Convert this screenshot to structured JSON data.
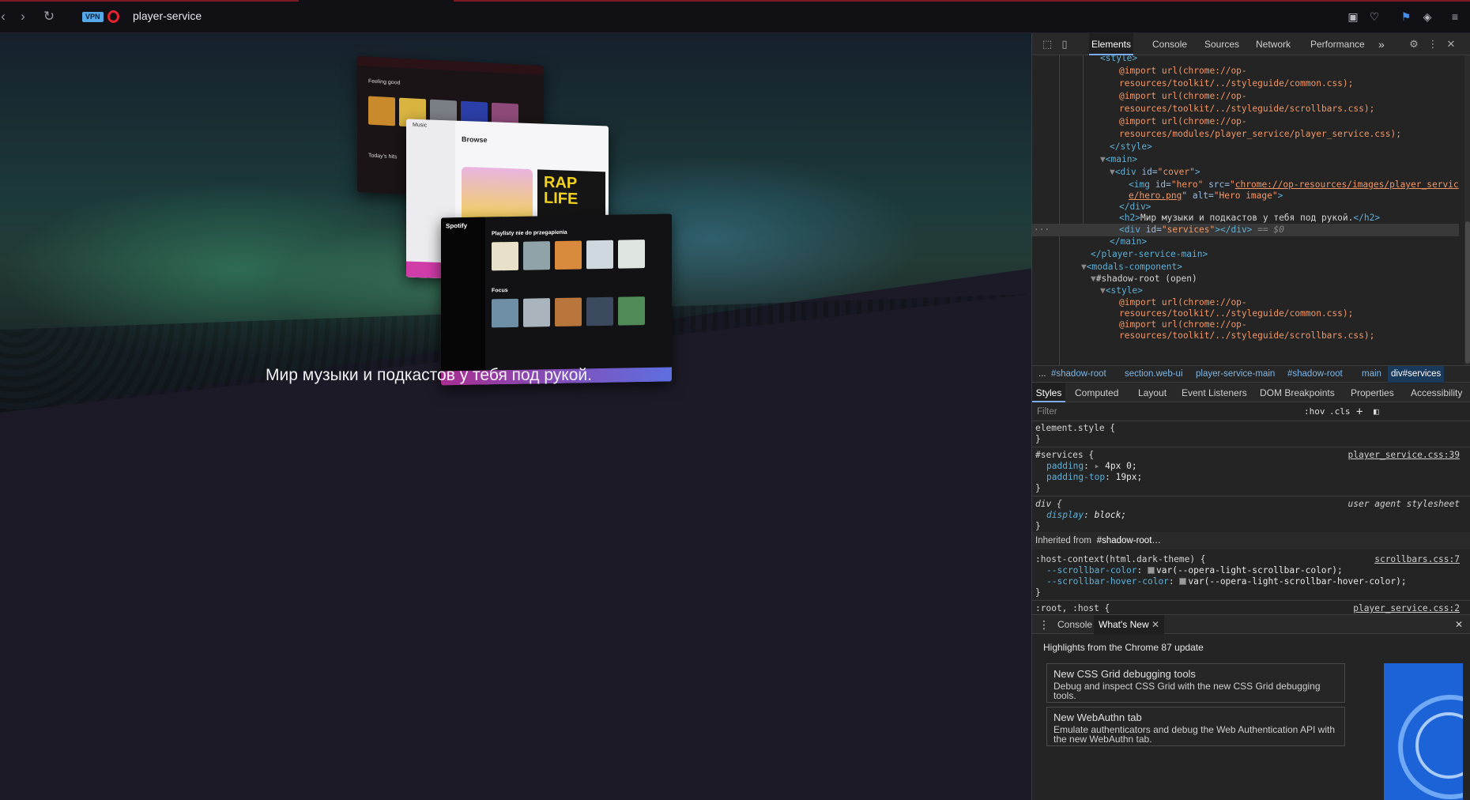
{
  "browser": {
    "vpn_label": "VPN",
    "address": "player-service",
    "back_icon": "chevron-left-icon",
    "forward_icon": "chevron-right-icon",
    "reload_icon": "reload-icon"
  },
  "page": {
    "headline": "Мир музыки и подкастов у тебя под рукой.",
    "preview": {
      "ytm_heading": "Feeling good",
      "ytm_subheading": "Today's hits",
      "apple_brand": "Music",
      "apple_title": "Browse",
      "rap_title": "RAP LIFE",
      "spotify_brand": "Spotify",
      "spotify_heading": "Playlisty nie do przegapienia",
      "spotify_subheading": "Focus"
    }
  },
  "devtools": {
    "tabs": [
      "Elements",
      "Console",
      "Sources",
      "Network",
      "Performance"
    ],
    "more_tabs": "»",
    "dom": {
      "l1": "<style>",
      "l2": "@import url(chrome://op-",
      "l3": "resources/toolkit/../styleguide/common.css);",
      "l4": "@import url(chrome://op-",
      "l5": "resources/toolkit/../styleguide/scrollbars.css);",
      "l6": "@import url(chrome://op-",
      "l7": "resources/modules/player_service/player_service.css);",
      "l8": "</style>",
      "l9": "<main>",
      "l10_tag": "<div ",
      "l10_attr": "id=",
      "l10_val": "\"cover\"",
      "l10_end": ">",
      "l11_tag": "<img ",
      "l11_attr1": "id=",
      "l11_val1": "\"hero\"",
      "l11_attr2": " src=",
      "l11_link1": "chrome://op-resources/images/player_servic",
      "l12_link2": "e/hero.png",
      "l12_attr3": "\" alt=",
      "l12_val3": "\"Hero image\"",
      "l12_end": ">",
      "l13": "</div>",
      "l14_tag": "<h2>",
      "l14_text": "Мир музыки и подкастов у тебя под рукой.",
      "l14_end": "</h2>",
      "l15_tag": "<div ",
      "l15_attr": "id=",
      "l15_val": "\"services\"",
      "l15_end": "></div>",
      "l15_ref": " == $0",
      "l16": "</main>",
      "l17": "</player-service-main>",
      "l18": "<modals-component>",
      "l19": "#shadow-root (open)",
      "l20": "<style>",
      "l21": "@import url(chrome://op-",
      "l22": "resources/toolkit/../styleguide/common.css);",
      "l23": "@import url(chrome://op-",
      "l24": "resources/toolkit/../styleguide/scrollbars.css);"
    },
    "breadcrumbs": [
      "...",
      "#shadow-root",
      "section.web-ui",
      "player-service-main",
      "#shadow-root",
      "main",
      "div#services"
    ],
    "styles_tabs": [
      "Styles",
      "Computed",
      "Layout",
      "Event Listeners",
      "DOM Breakpoints",
      "Properties",
      "Accessibility"
    ],
    "filter_placeholder": "Filter",
    "hov": ":hov",
    "cls": ".cls",
    "plus": "+",
    "rules": {
      "element_style": "element.style {",
      "close": "}",
      "services_sel": "#services {",
      "services_src": "player_service.css:39",
      "padding_prop": "padding",
      "padding_val": "4px 0;",
      "padding_top_prop": "padding-top",
      "padding_top_val": "19px;",
      "div_sel": "div {",
      "div_src": "user agent stylesheet",
      "display_prop": "display",
      "display_val": "block;",
      "inherited_label": "Inherited from",
      "inherited_node": "#shadow-root…",
      "host_sel": ":host-context(html.dark-theme) {",
      "host_src": "scrollbars.css:7",
      "sb_color_prop": "--scrollbar-color",
      "sb_color_val": "var(--opera-light-scrollbar-color);",
      "sb_hover_prop": "--scrollbar-hover-color",
      "sb_hover_val": "var(--opera-light-scrollbar-hover-color);",
      "root_sel": ":root, :host {",
      "root_src": "player_service.css:2"
    },
    "drawer": {
      "tab_console": "Console",
      "tab_whats_new": "What's New",
      "highlights": "Highlights from the Chrome 87 update",
      "cards": [
        {
          "title": "New CSS Grid debugging tools",
          "desc": "Debug and inspect CSS Grid with the new CSS Grid debugging tools."
        },
        {
          "title": "New WebAuthn tab",
          "desc": "Emulate authenticators and debug the Web Authentication API with the new WebAuthn tab."
        }
      ]
    }
  }
}
